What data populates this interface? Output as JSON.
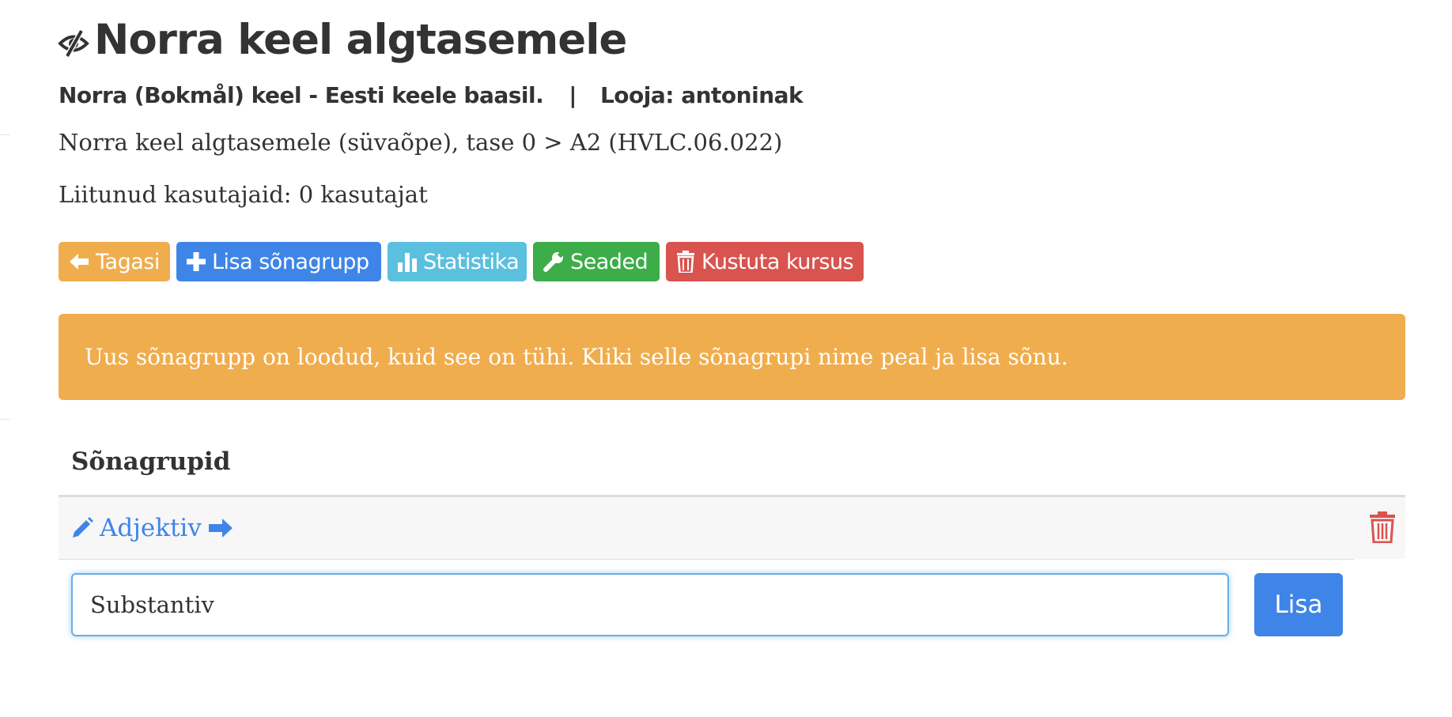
{
  "course": {
    "title": "Norra keel algtasemele",
    "language_pair": "Norra (Bokmål) keel - Eesti keele baasil.",
    "separator": "|",
    "creator": "Looja: antoninak",
    "description": "Norra keel algtasemele (süvaõpe), tase 0 > A2 (HVLC.06.022)",
    "joined_users": "Liitunud kasutajaid: 0 kasutajat"
  },
  "toolbar": {
    "back_label": "Tagasi",
    "add_group_label": "Lisa sõnagrupp",
    "stats_label": "Statistika",
    "settings_label": "Seaded",
    "delete_course_label": "Kustuta kursus"
  },
  "alert": {
    "message": "Uus sõnagrupp on loodud, kuid see on tühi. Kliki selle sõnagrupi nime peal ja lisa sõnu."
  },
  "word_groups": {
    "header": "Sõnagrupid",
    "items": [
      {
        "name": "Adjektiv"
      }
    ]
  },
  "new_group_form": {
    "value": "Substantiv",
    "submit_label": "Lisa"
  },
  "colors": {
    "warning": "#f0ad4e",
    "primary": "#3f85e8",
    "info": "#5bc0de",
    "success": "#3cad48",
    "danger": "#d9534f"
  },
  "icons": {
    "title": "eye-slash-icon",
    "back": "arrow-left-icon",
    "add": "plus-icon",
    "stats": "bar-chart-icon",
    "settings": "wrench-icon",
    "delete": "trash-icon",
    "edit": "pencil-icon",
    "open": "arrow-right-icon"
  }
}
